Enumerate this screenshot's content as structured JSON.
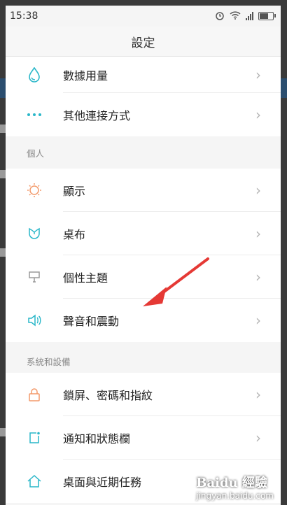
{
  "status": {
    "time": "15:38"
  },
  "header": {
    "title": "設定"
  },
  "top_items": [
    {
      "label": "數據用量",
      "icon": "water-drop-icon"
    },
    {
      "label": "其他連接方式",
      "icon": "more-dots-icon"
    }
  ],
  "personal": {
    "section_label": "個人",
    "items": [
      {
        "label": "顯示",
        "icon": "sun-icon"
      },
      {
        "label": "桌布",
        "icon": "flower-icon"
      },
      {
        "label": "個性主題",
        "icon": "brush-icon"
      },
      {
        "label": "聲音和震動",
        "icon": "speaker-icon"
      }
    ]
  },
  "system": {
    "section_label": "系統和設備",
    "items": [
      {
        "label": "鎖屏、密碼和指紋",
        "icon": "lock-icon"
      },
      {
        "label": "通知和狀態欄",
        "icon": "notification-icon"
      },
      {
        "label": "桌面與近期任務",
        "icon": "home-icon"
      }
    ]
  },
  "colors": {
    "accent": "#e53935",
    "icon_teal": "#2ab7c9",
    "icon_orange": "#f39a6b"
  },
  "watermark": {
    "logo": "Baidu 經驗",
    "url": "jingyan.baidu.com"
  }
}
